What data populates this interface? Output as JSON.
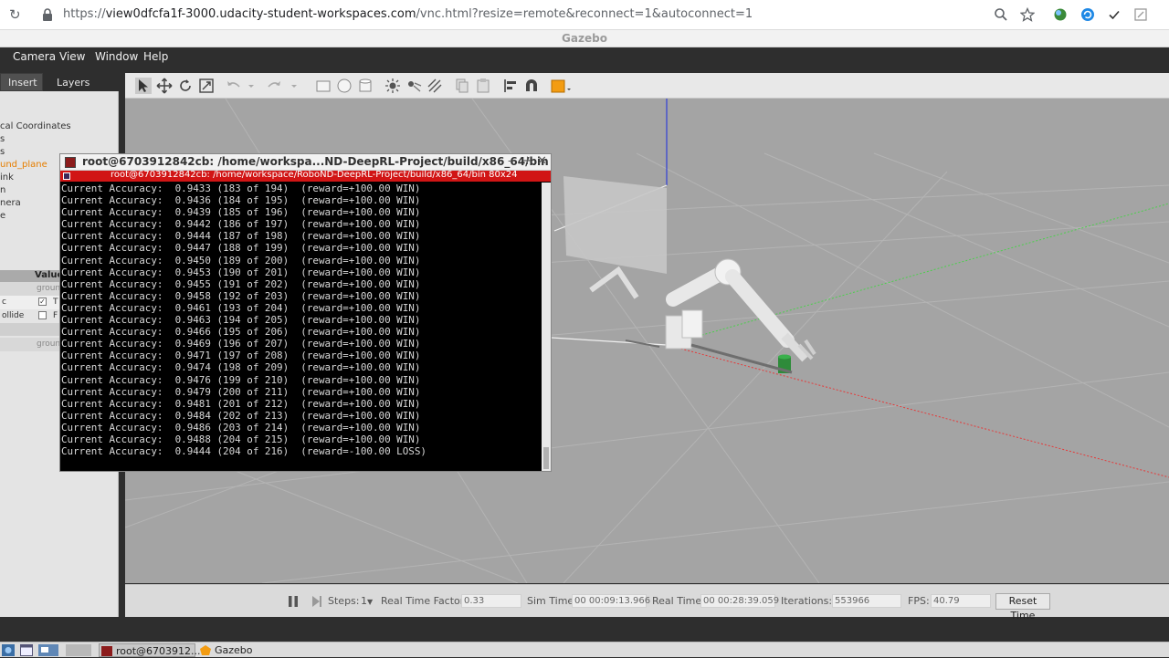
{
  "browser": {
    "url_prefix": "https://",
    "url_host": "view0dfcfa1f-3000.udacity-student-workspaces.com",
    "url_rest": "/vnc.html?resize=remote&reconnect=1&autoconnect=1"
  },
  "window_title": "Gazebo",
  "menu": [
    "Camera",
    "View",
    "Window",
    "Help"
  ],
  "left_panel": {
    "tabs": [
      "Insert",
      "Layers"
    ],
    "tree_items": [
      "cal Coordinates",
      "s",
      "s",
      "und_plane",
      "ink",
      "n",
      "nera",
      "e"
    ],
    "selected_item": "und_plane",
    "props_header_value": "Value",
    "prop_rows": [
      {
        "label": "",
        "value": "groun"
      },
      {
        "label": "c",
        "value": "T"
      },
      {
        "label": "ollide",
        "value": "F"
      },
      {
        "label": "",
        "value": ""
      },
      {
        "label": "",
        "value": "groun"
      }
    ]
  },
  "terminal": {
    "title": "root@6703912842cb: /home/workspa...ND-DeepRL-Project/build/x86_64/bin",
    "subtitle": "root@6703912842cb: /home/workspace/RoboND-DeepRL-Project/build/x86_64/bin 80x24",
    "lines": [
      "Current Accuracy:  0.9433 (183 of 194)  (reward=+100.00 WIN)",
      "Current Accuracy:  0.9436 (184 of 195)  (reward=+100.00 WIN)",
      "Current Accuracy:  0.9439 (185 of 196)  (reward=+100.00 WIN)",
      "Current Accuracy:  0.9442 (186 of 197)  (reward=+100.00 WIN)",
      "Current Accuracy:  0.9444 (187 of 198)  (reward=+100.00 WIN)",
      "Current Accuracy:  0.9447 (188 of 199)  (reward=+100.00 WIN)",
      "Current Accuracy:  0.9450 (189 of 200)  (reward=+100.00 WIN)",
      "Current Accuracy:  0.9453 (190 of 201)  (reward=+100.00 WIN)",
      "Current Accuracy:  0.9455 (191 of 202)  (reward=+100.00 WIN)",
      "Current Accuracy:  0.9458 (192 of 203)  (reward=+100.00 WIN)",
      "Current Accuracy:  0.9461 (193 of 204)  (reward=+100.00 WIN)",
      "Current Accuracy:  0.9463 (194 of 205)  (reward=+100.00 WIN)",
      "Current Accuracy:  0.9466 (195 of 206)  (reward=+100.00 WIN)",
      "Current Accuracy:  0.9469 (196 of 207)  (reward=+100.00 WIN)",
      "Current Accuracy:  0.9471 (197 of 208)  (reward=+100.00 WIN)",
      "Current Accuracy:  0.9474 (198 of 209)  (reward=+100.00 WIN)",
      "Current Accuracy:  0.9476 (199 of 210)  (reward=+100.00 WIN)",
      "Current Accuracy:  0.9479 (200 of 211)  (reward=+100.00 WIN)",
      "Current Accuracy:  0.9481 (201 of 212)  (reward=+100.00 WIN)",
      "Current Accuracy:  0.9484 (202 of 213)  (reward=+100.00 WIN)",
      "Current Accuracy:  0.9486 (203 of 214)  (reward=+100.00 WIN)",
      "Current Accuracy:  0.9488 (204 of 215)  (reward=+100.00 WIN)",
      "Current Accuracy:  0.9444 (204 of 216)  (reward=-100.00 LOSS)"
    ]
  },
  "status": {
    "steps_label": "Steps:",
    "steps_value": "1",
    "rtf_label": "Real Time Factor:",
    "rtf_value": "0.33",
    "sim_time_label": "Sim Time:",
    "sim_time_value": "00 00:09:13.966",
    "real_time_label": "Real Time:",
    "real_time_value": "00 00:28:39.059",
    "iterations_label": "Iterations:",
    "iterations_value": "553966",
    "fps_label": "FPS:",
    "fps_value": "40.79",
    "reset_label": "Reset Time"
  },
  "taskbar": {
    "terminal_task": "root@6703912...",
    "gazebo_task": "Gazebo"
  },
  "colors": {
    "selected_item": "#e67e00",
    "terminal_subtitle_bar": "#d11515",
    "viewport_ground": "#a4a4a4"
  }
}
